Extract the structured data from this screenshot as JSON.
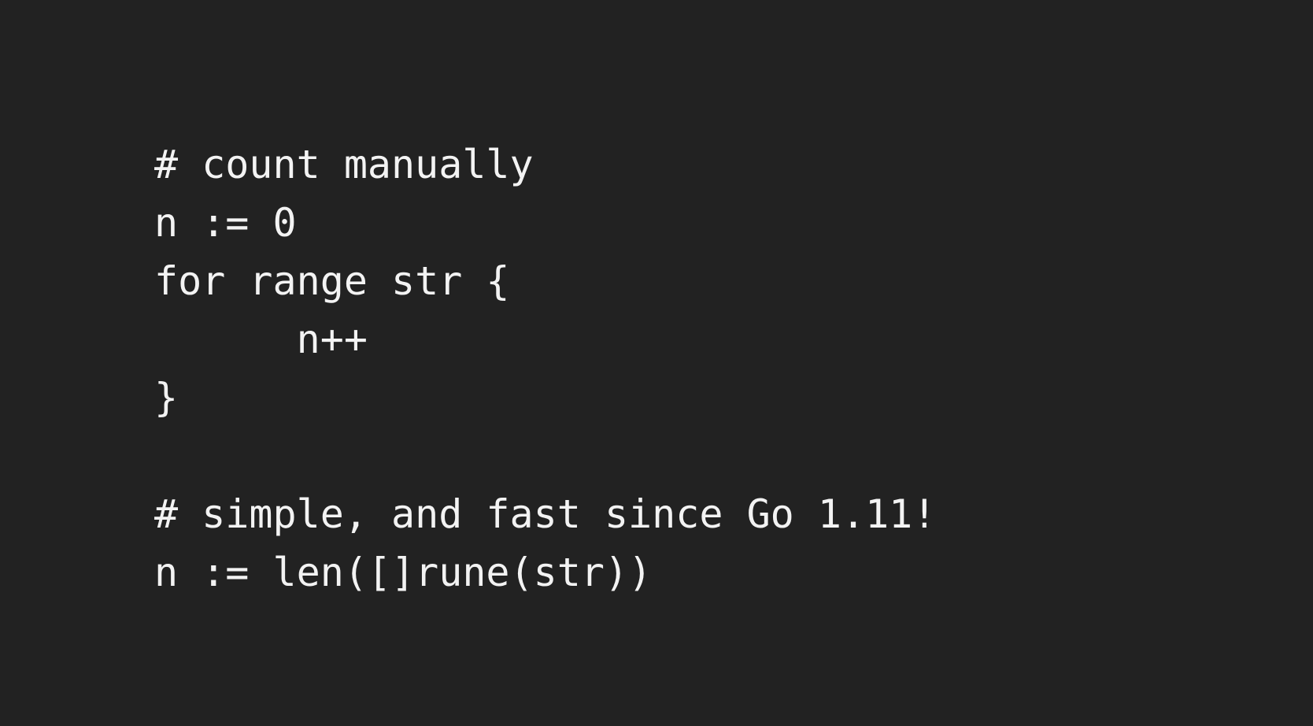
{
  "slide": {
    "background_color": "#222222",
    "text_color": "#f3f3f3"
  },
  "code": {
    "lines": [
      "# count manually",
      "n := 0",
      "for range str {",
      "      n++",
      "}",
      "",
      "# simple, and fast since Go 1.11!",
      "n := len([]rune(str))"
    ]
  }
}
